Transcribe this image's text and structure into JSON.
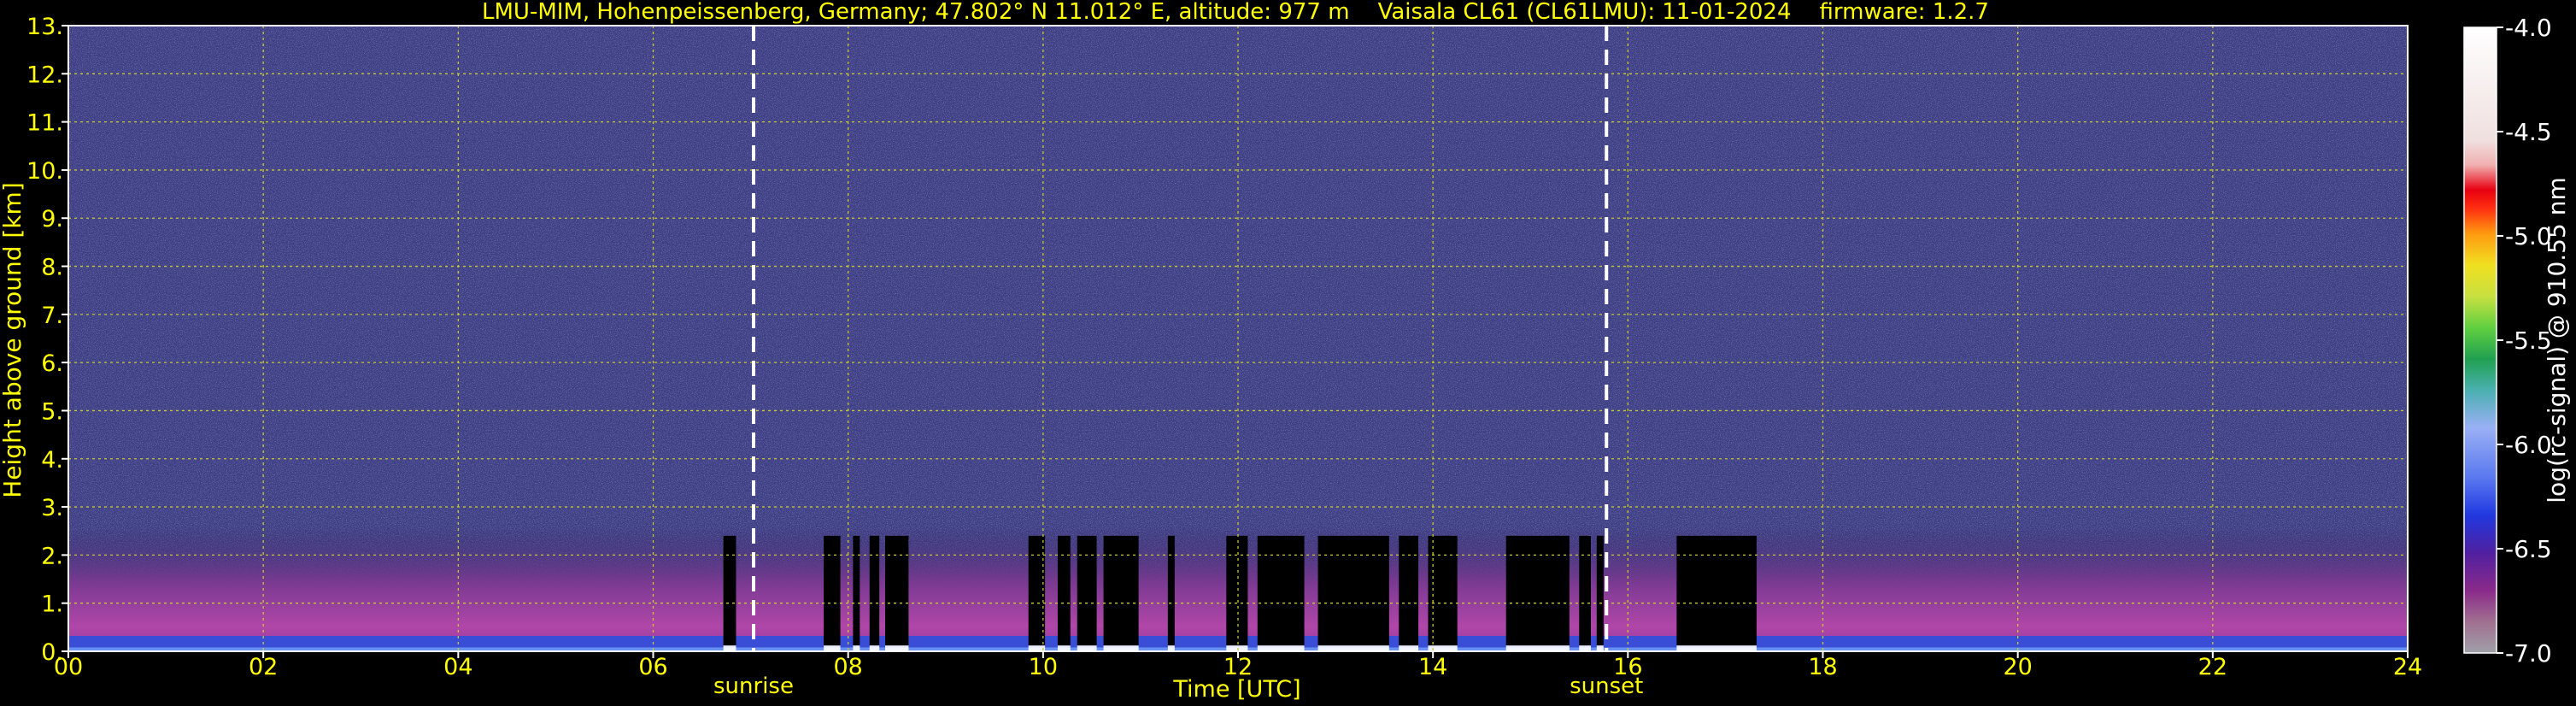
{
  "chart_data": {
    "type": "heatmap",
    "title": "LMU-MIM, Hohenpeissenberg, Germany; 47.802° N 11.012° E, altitude: 977 m    Vaisala CL61 (CL61LMU): 11-01-2024    firmware: 1.2.7",
    "xlabel": "Time [UTC]",
    "ylabel": "Height above ground [km]",
    "xlim": [
      0,
      24
    ],
    "ylim": [
      0,
      13
    ],
    "x_ticks": [
      "00",
      "02",
      "04",
      "06",
      "08",
      "10",
      "12",
      "14",
      "16",
      "18",
      "20",
      "22",
      "24"
    ],
    "y_ticks": [
      "0.",
      "1.",
      "2.",
      "3.",
      "4.",
      "5.",
      "6.",
      "7.",
      "8.",
      "9.",
      "10.",
      "11.",
      "12.",
      "13."
    ],
    "grid": true,
    "colorbar": {
      "label": "log(rc-signal) @ 910.55 nm",
      "range": [
        -7.0,
        -4.0
      ],
      "ticks": [
        "-4.0",
        "-4.5",
        "-5.0",
        "-5.5",
        "-6.0",
        "-6.5",
        "-7.0"
      ]
    },
    "annotations": [
      {
        "label": "sunrise",
        "x": 7.03
      },
      {
        "label": "sunset",
        "x": 15.78
      }
    ],
    "cloud_periods": [
      [
        6.72,
        6.85
      ],
      [
        7.75,
        7.92
      ],
      [
        8.05,
        8.12
      ],
      [
        8.22,
        8.32
      ],
      [
        8.38,
        8.62
      ],
      [
        9.85,
        10.02
      ],
      [
        10.15,
        10.28
      ],
      [
        10.35,
        10.55
      ],
      [
        10.62,
        10.98
      ],
      [
        11.28,
        11.35
      ],
      [
        11.88,
        12.1
      ],
      [
        12.2,
        12.68
      ],
      [
        12.82,
        13.55
      ],
      [
        13.65,
        13.85
      ],
      [
        13.95,
        14.25
      ],
      [
        14.75,
        15.4
      ],
      [
        15.5,
        15.62
      ],
      [
        15.68,
        15.75
      ],
      [
        16.5,
        17.32
      ]
    ],
    "colors": {
      "grid": "#c8c832",
      "text": "#ffff00",
      "background_noise": "#3c3c82",
      "boundary_layer": "#a03ca0",
      "surface_layer": "#2850e0",
      "cloud": "#000000"
    }
  }
}
